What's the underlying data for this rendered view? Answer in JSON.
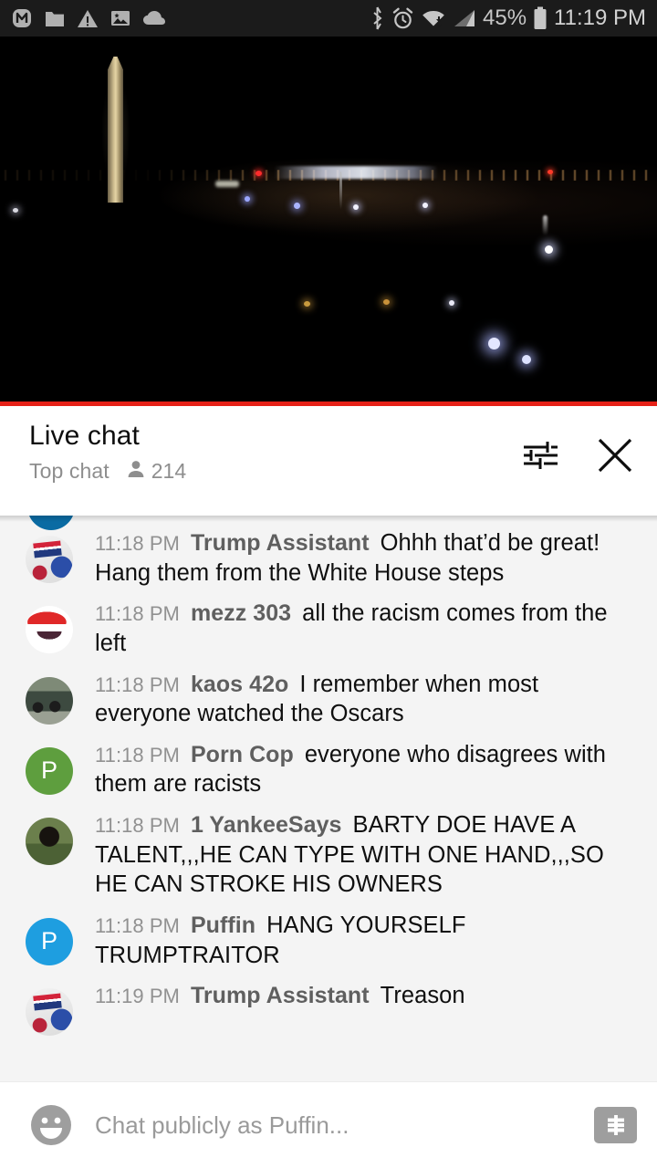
{
  "statusbar": {
    "left_icons": [
      "m-badge-icon",
      "folder-icon",
      "warning-icon",
      "image-icon",
      "cloud-icon"
    ],
    "right_icons": [
      "bluetooth-icon",
      "alarm-icon",
      "wifi-icon",
      "cellular-signal-icon",
      "battery-icon"
    ],
    "battery_percent": "45%",
    "time": "11:19 PM"
  },
  "video": {
    "name": "live-video-player",
    "progress_bar_color": "#e62117",
    "scene": "Washington Monument at night"
  },
  "chat_header": {
    "title": "Live chat",
    "mode_label": "Top chat",
    "viewer_count": "214",
    "settings_icon": "tune-sliders-icon",
    "close_icon": "close-x-icon"
  },
  "messages": [
    {
      "timestamp": "11:18 PM",
      "author": "Trump Assistant",
      "text": "Ohhh that’d be great! Hang them from the White House steps",
      "avatar_type": "image",
      "avatar_class": "av-trump",
      "avatar_letter": ""
    },
    {
      "timestamp": "11:18 PM",
      "author": "mezz 303",
      "text": "all the racism comes from the left",
      "avatar_type": "image",
      "avatar_class": "av-mezz",
      "avatar_letter": ""
    },
    {
      "timestamp": "11:18 PM",
      "author": "kaos 42o",
      "text": "I remember when most everyone watched the Oscars",
      "avatar_type": "image",
      "avatar_class": "av-kaos",
      "avatar_letter": ""
    },
    {
      "timestamp": "11:18 PM",
      "author": "Porn Cop",
      "text": "everyone who disagrees with them are racists",
      "avatar_type": "letter",
      "avatar_color": "#5e9e3e",
      "avatar_letter": "P"
    },
    {
      "timestamp": "11:18 PM",
      "author": "1 YankeeSays",
      "text": "BARTY DOE HAVE A TALENT,,,HE CAN TYPE WITH ONE HAND,,,SO HE CAN STROKE HIS OWNERS",
      "avatar_type": "image",
      "avatar_class": "av-yankee",
      "avatar_letter": ""
    },
    {
      "timestamp": "11:18 PM",
      "author": "Puffin",
      "text": "HANG YOURSELF TRUMPTRAITOR",
      "avatar_type": "letter",
      "avatar_color": "#1e9ee0",
      "avatar_letter": "P"
    },
    {
      "timestamp": "11:19 PM",
      "author": "Trump Assistant",
      "text": "Treason",
      "avatar_type": "image",
      "avatar_class": "av-trump",
      "avatar_letter": ""
    }
  ],
  "input_bar": {
    "emoji_icon": "emoji-smiley-icon",
    "placeholder": "Chat publicly as Puffin...",
    "value": "",
    "superchat_icon": "super-chat-dollar-icon"
  },
  "colors": {
    "accent_red": "#e62117",
    "chat_bg": "#f4f4f4",
    "status_bg": "#1b1b1b"
  }
}
